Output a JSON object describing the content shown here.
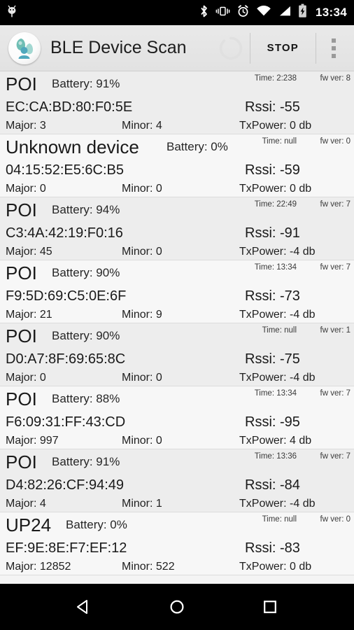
{
  "statusbar": {
    "notification_icon": "android-bug-icon",
    "icons": [
      "bluetooth-icon",
      "vibrate-icon",
      "alarm-icon",
      "wifi-icon",
      "cellular-signal-icon",
      "battery-charging-icon"
    ],
    "clock": "13:34"
  },
  "actionbar": {
    "logo_icon": "app-logo-icon",
    "title": "BLE Device Scan",
    "spinner_icon": "progress-spinner-icon",
    "stop_label": "STOP",
    "overflow_icon": "overflow-menu-icon"
  },
  "devices": [
    {
      "name": "POI",
      "battery": "Battery: 91%",
      "time": "Time: 2:238",
      "fw": "fw ver: 8",
      "mac": "EC:CA:BD:80:F0:5E",
      "rssi": "Rssi: -55",
      "major": "Major: 3",
      "minor": "Minor: 4",
      "txpower": "TxPower: 0 db"
    },
    {
      "name": "Unknown device",
      "battery": "Battery: 0%",
      "time": "Time: null",
      "fw": "fw ver: 0",
      "mac": "04:15:52:E5:6C:B5",
      "rssi": "Rssi: -59",
      "major": "Major: 0",
      "minor": "Minor: 0",
      "txpower": "TxPower: 0 db"
    },
    {
      "name": "POI",
      "battery": "Battery: 94%",
      "time": "Time: 22:49",
      "fw": "fw ver: 7",
      "mac": "C3:4A:42:19:F0:16",
      "rssi": "Rssi: -91",
      "major": "Major: 45",
      "minor": "Minor: 0",
      "txpower": "TxPower: -4 db"
    },
    {
      "name": "POI",
      "battery": "Battery: 90%",
      "time": "Time: 13:34",
      "fw": "fw ver: 7",
      "mac": "F9:5D:69:C5:0E:6F",
      "rssi": "Rssi: -73",
      "major": "Major: 21",
      "minor": "Minor: 9",
      "txpower": "TxPower: -4 db"
    },
    {
      "name": "POI",
      "battery": "Battery: 90%",
      "time": "Time: null",
      "fw": "fw ver: 1",
      "mac": "D0:A7:8F:69:65:8C",
      "rssi": "Rssi: -75",
      "major": "Major: 0",
      "minor": "Minor: 0",
      "txpower": "TxPower: -4 db"
    },
    {
      "name": "POI",
      "battery": "Battery: 88%",
      "time": "Time: 13:34",
      "fw": "fw ver: 7",
      "mac": "F6:09:31:FF:43:CD",
      "rssi": "Rssi: -95",
      "major": "Major: 997",
      "minor": "Minor: 0",
      "txpower": "TxPower: 4 db"
    },
    {
      "name": "POI",
      "battery": "Battery: 91%",
      "time": "Time: 13:36",
      "fw": "fw ver: 7",
      "mac": "D4:82:26:CF:94:49",
      "rssi": "Rssi: -84",
      "major": "Major: 4",
      "minor": "Minor: 1",
      "txpower": "TxPower: -4 db"
    },
    {
      "name": "UP24",
      "battery": "Battery: 0%",
      "time": "Time: null",
      "fw": "fw ver: 0",
      "mac": "EF:9E:8E:F7:EF:12",
      "rssi": "Rssi: -83",
      "major": "Major: 12852",
      "minor": "Minor: 522",
      "txpower": "TxPower: 0 db"
    }
  ],
  "navbar": {
    "back_icon": "back-triangle-icon",
    "home_icon": "home-circle-icon",
    "recents_icon": "recents-square-icon"
  },
  "colors": {
    "statusbar_bg": "#000000",
    "actionbar_bg": "#e6e6e6",
    "row_alt_bg": "#ededed",
    "row_base_bg": "#f7f7f7",
    "text_primary": "#1a1a1a"
  }
}
